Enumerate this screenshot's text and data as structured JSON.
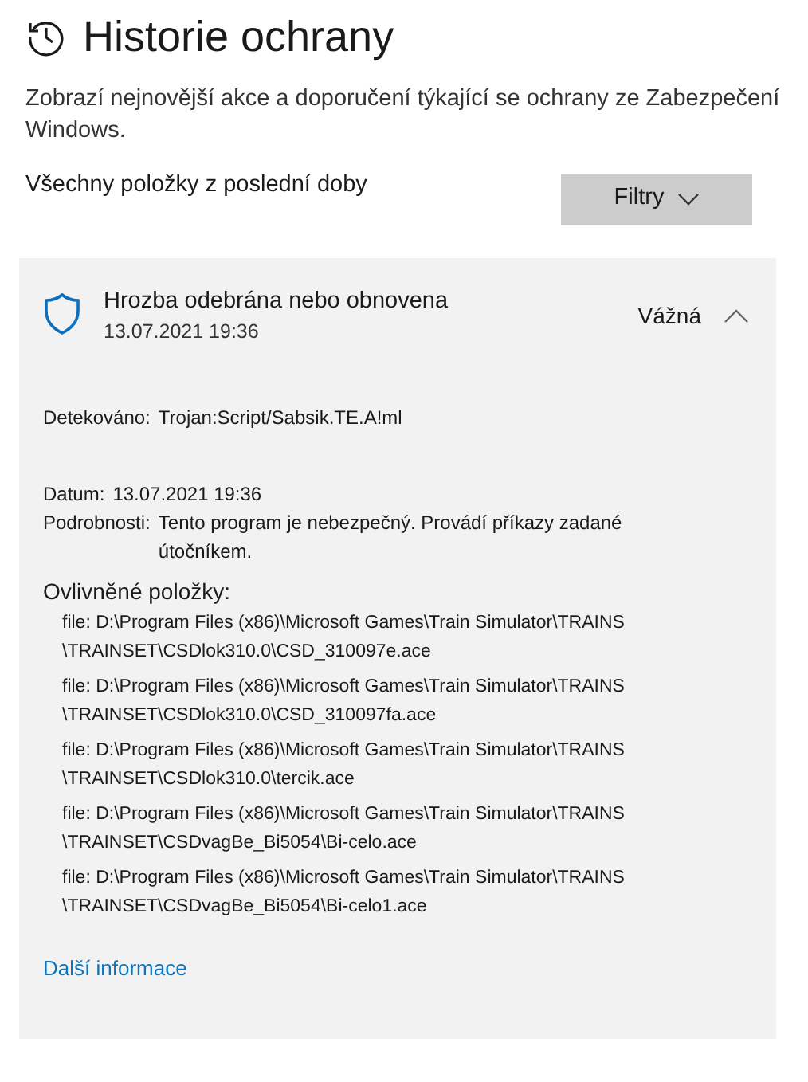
{
  "page_title": "Historie ochrany",
  "description": "Zobrazí nejnovější akce a doporučení týkající se ochrany ze Zabezpečení Windows.",
  "filter_label": "Všechny položky z poslední doby",
  "filter_button": "Filtry",
  "event": {
    "title": "Hrozba odebrána nebo obnovena",
    "date": "13.07.2021 19:36",
    "severity": "Vážná",
    "expanded": true,
    "detail_groups": [
      [
        {
          "label": "Detekováno:",
          "value": "Trojan:Script/Sabsik.TE.A!ml"
        }
      ],
      [
        {
          "label": "Datum:",
          "value": "13.07.2021 19:36"
        },
        {
          "label": "Podrobnosti:",
          "value": "Tento program je nebezpečný. Provádí příkazy zadané útočníkem."
        }
      ]
    ],
    "affected_heading": "Ovlivněné položky:",
    "affected_items": [
      {
        "lines": [
          "file: D:\\Program Files (x86)\\Microsoft Games\\Train Simulator\\TRAINS",
          "\\TRAINSET\\CSDlok310.0\\CSD_310097e.ace"
        ]
      },
      {
        "lines": [
          "file: D:\\Program Files (x86)\\Microsoft Games\\Train Simulator\\TRAINS",
          "\\TRAINSET\\CSDlok310.0\\CSD_310097fa.ace"
        ]
      },
      {
        "lines": [
          "file: D:\\Program Files (x86)\\Microsoft Games\\Train Simulator\\TRAINS",
          "\\TRAINSET\\CSDlok310.0\\tercik.ace"
        ]
      },
      {
        "lines": [
          "file: D:\\Program Files (x86)\\Microsoft Games\\Train Simulator\\TRAINS",
          "\\TRAINSET\\CSDvagBe_Bi5054\\Bi-celo.ace"
        ]
      },
      {
        "lines": [
          "file: D:\\Program Files (x86)\\Microsoft Games\\Train Simulator\\TRAINS",
          "\\TRAINSET\\CSDvagBe_Bi5054\\Bi-celo1.ace"
        ]
      }
    ],
    "more_link": "Další informace"
  }
}
